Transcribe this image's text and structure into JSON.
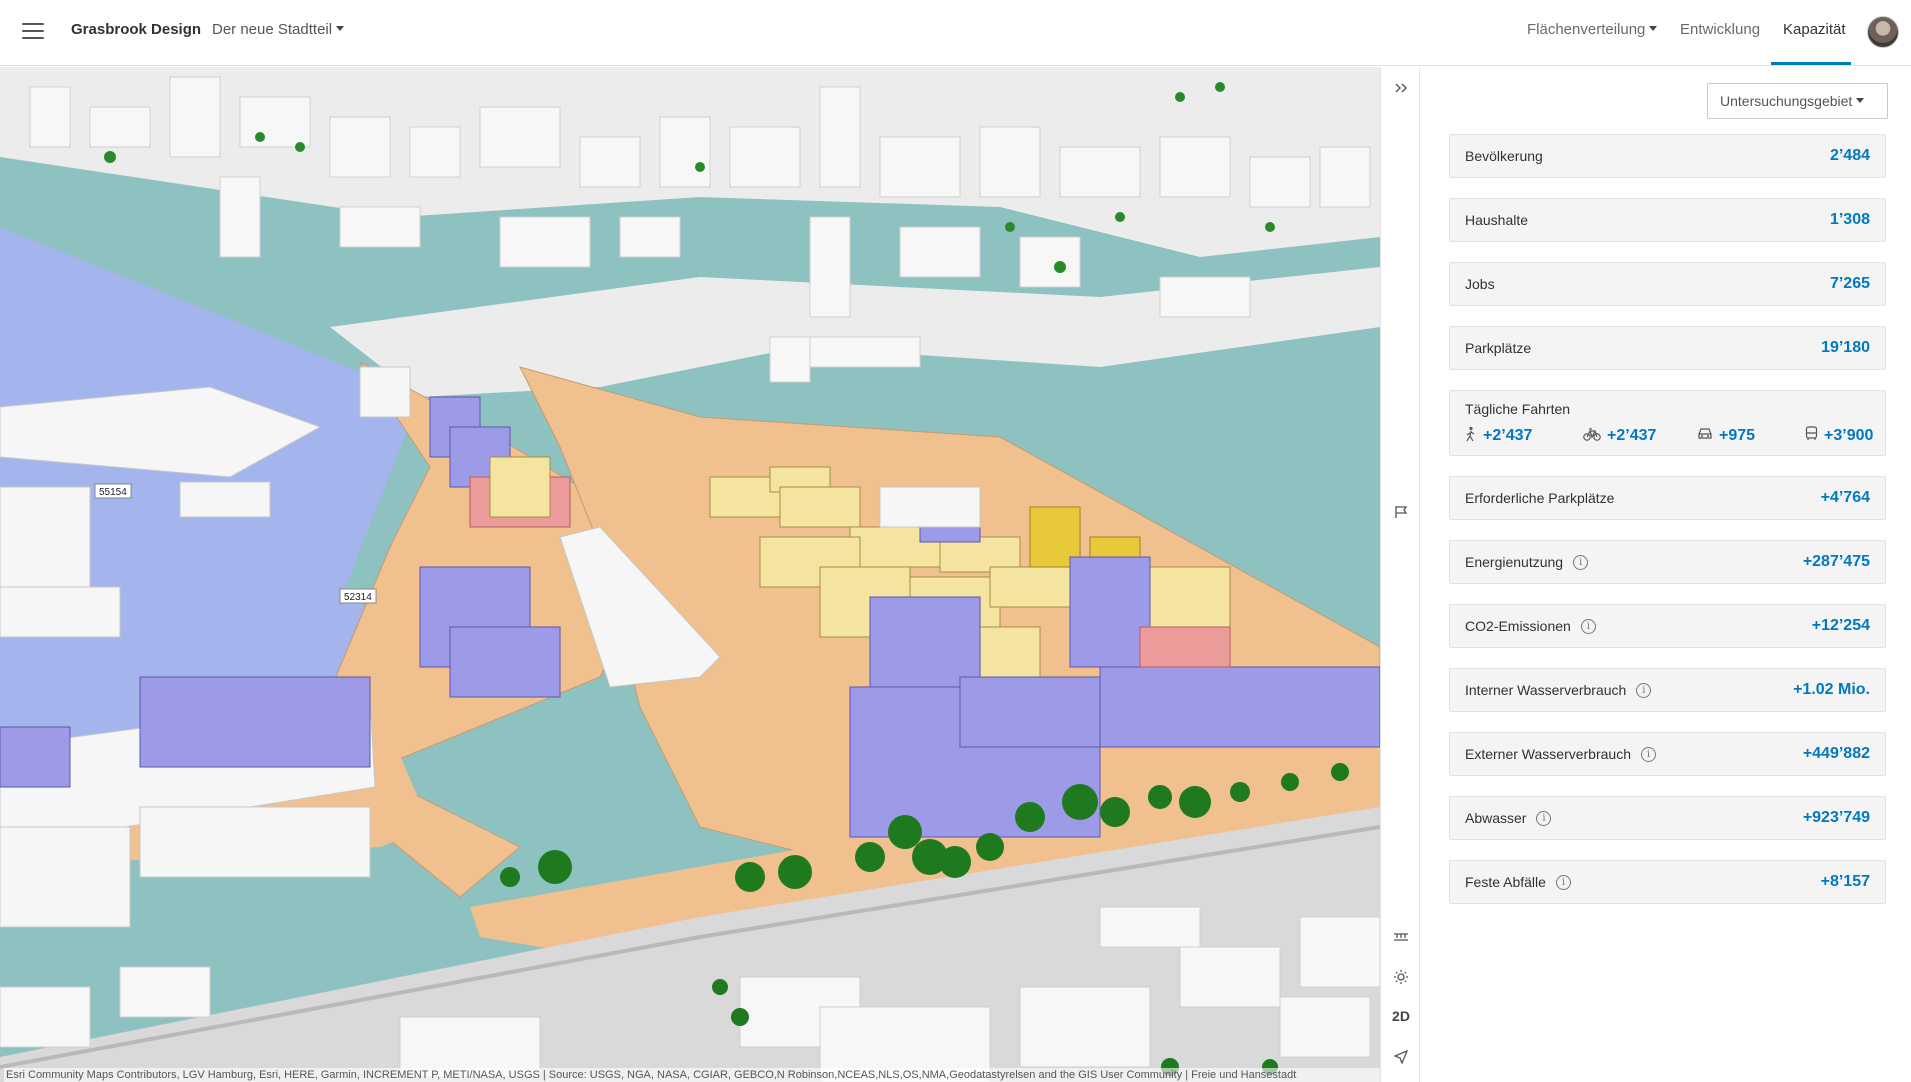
{
  "header": {
    "app_title": "Grasbrook Design",
    "scenario_label": "Der neue Stadtteil",
    "nav": [
      {
        "label": "Flächenverteilung",
        "has_dropdown": true
      },
      {
        "label": "Entwicklung"
      },
      {
        "label": "Kapazität",
        "active": true
      }
    ]
  },
  "map": {
    "labels": [
      "55154",
      "52314"
    ],
    "attribution": "Esri Community Maps Contributors, LGV Hamburg, Esri, HERE, Garmin, INCREMENT P, METI/NASA, USGS | Source: USGS, NGA, NASA, CGIAR, GEBCO,N Robinson,NCEAS,NLS,OS,NMA,Geodatastyrelsen and the GIS User Community | Freie und Hansestadt",
    "tools": [
      "collapse-panel",
      "daylight-flag",
      "measure",
      "sun",
      "2D",
      "locate"
    ],
    "mode_label": "2D"
  },
  "panel": {
    "area_select": "Untersuchungsgebiet",
    "metrics": [
      {
        "label": "Bevölkerung",
        "value": "2’484"
      },
      {
        "label": "Haushalte",
        "value": "1’308"
      },
      {
        "label": "Jobs",
        "value": "7’265"
      },
      {
        "label": "Parkplätze",
        "value": "19’180"
      }
    ],
    "trips": {
      "label": "Tägliche Fahrten",
      "walk": "+2’437",
      "bike": "+2’437",
      "car": "+975",
      "transit": "+3’900"
    },
    "more_metrics": [
      {
        "label": "Erforderliche Parkplätze",
        "value": "+4’764",
        "info": false
      },
      {
        "label": "Energienutzung",
        "value": "+287’475",
        "info": true
      },
      {
        "label": "CO2-Emissionen",
        "value": "+12’254",
        "info": true
      },
      {
        "label": "Interner Wasserverbrauch",
        "value": "+1.02 Mio.",
        "info": true
      },
      {
        "label": "Externer Wasserverbrauch",
        "value": "+449’882",
        "info": true
      },
      {
        "label": "Abwasser",
        "value": "+923’749",
        "info": true
      },
      {
        "label": "Feste Abfälle",
        "value": "+8’157",
        "info": true
      }
    ]
  },
  "colors": {
    "accent": "#0079c1",
    "water": "#8ec2c0",
    "land_orange": "#f0c08e",
    "residential_yellow": "#f4e4a0",
    "office_purple": "#9d9ae8",
    "water_blue": "#9fb0ea"
  }
}
